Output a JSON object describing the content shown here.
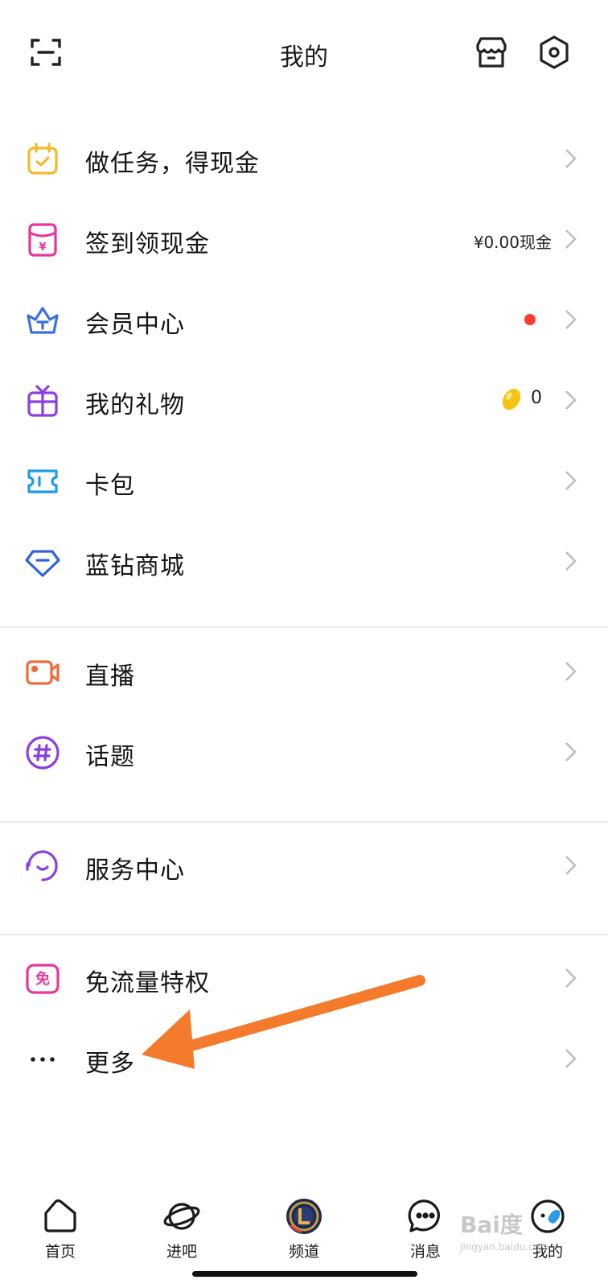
{
  "header": {
    "title": "我的"
  },
  "menu": [
    {
      "label": "做任务，得现金"
    },
    {
      "label": "签到领现金",
      "extra": "¥0.00现金"
    },
    {
      "label": "会员中心"
    },
    {
      "label": "我的礼物",
      "extra": "0"
    },
    {
      "label": "卡包"
    },
    {
      "label": "蓝钻商城"
    },
    {
      "label": "直播"
    },
    {
      "label": "话题"
    },
    {
      "label": "服务中心"
    },
    {
      "label": "免流量特权",
      "icon_text": "免"
    },
    {
      "label": "更多"
    }
  ],
  "tabs": [
    {
      "label": "首页"
    },
    {
      "label": "进吧"
    },
    {
      "label": "频道"
    },
    {
      "label": "消息"
    },
    {
      "label": "我的"
    }
  ],
  "watermark": {
    "brand": "Bai度",
    "url": "jingyan.baidu.com"
  },
  "colors": {
    "task": "#f5b92a",
    "signin": "#e8359a",
    "vip": "#3a6fe0",
    "gift": "#8a3fe0",
    "card": "#1e9be8",
    "diamond": "#2f63d8",
    "live": "#ef6a3c",
    "topic": "#8a3fe0",
    "service": "#8a3fe0",
    "free": "#e8359a",
    "badge": "#ff3b30",
    "arrow": "#f47a2c"
  }
}
